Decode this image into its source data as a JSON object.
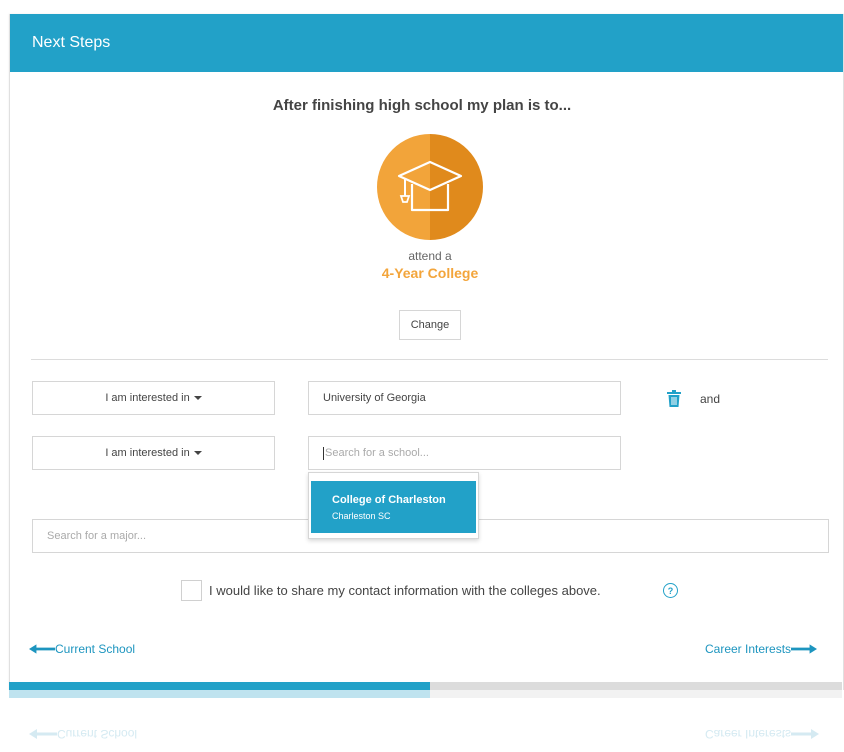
{
  "header": {
    "title": "Next Steps"
  },
  "plan": {
    "question": "After finishing high school my plan is to...",
    "icon": "graduation-cap-icon",
    "prefix": "attend a",
    "choice": "4-Year College",
    "change_label": "Change"
  },
  "interests": [
    {
      "select_label": "I am interested in",
      "school_value": "University of Georgia",
      "and_label": "and"
    },
    {
      "select_label": "I am interested in",
      "school_placeholder": "Search for a school..."
    }
  ],
  "dropdown": {
    "items": [
      {
        "name": "College of Charleston",
        "location": "Charleston SC"
      }
    ]
  },
  "major": {
    "placeholder": "Search for a major..."
  },
  "share": {
    "label": "I would like to share my contact information with the colleges above.",
    "help": "?"
  },
  "nav": {
    "prev_label": "Current School",
    "next_label": "Career Interests"
  },
  "progress": {
    "fraction": 0.5
  },
  "colors": {
    "accent": "#22a1c8",
    "orange": "#f2a43a",
    "orange_dark": "#e08a1c"
  }
}
